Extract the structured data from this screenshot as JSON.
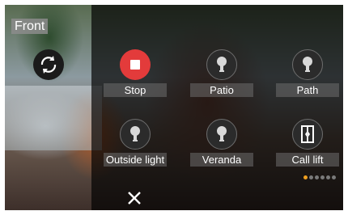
{
  "camera": {
    "label": "Front"
  },
  "controls": [
    {
      "id": "stop",
      "label": "Stop",
      "icon": "stop-icon",
      "active": true
    },
    {
      "id": "patio",
      "label": "Patio",
      "icon": "bulb-icon",
      "active": false
    },
    {
      "id": "path",
      "label": "Path",
      "icon": "bulb-icon",
      "active": false
    },
    {
      "id": "outside-light",
      "label": "Outside light",
      "icon": "bulb-icon",
      "active": false
    },
    {
      "id": "veranda",
      "label": "Veranda",
      "icon": "bulb-icon",
      "active": false
    },
    {
      "id": "call-lift",
      "label": "Call lift",
      "icon": "lift-icon",
      "active": false
    }
  ],
  "pagination": {
    "pages": 6,
    "current": 1
  },
  "colors": {
    "active_control": "#e33b3b",
    "active_dot": "#f0a020"
  }
}
